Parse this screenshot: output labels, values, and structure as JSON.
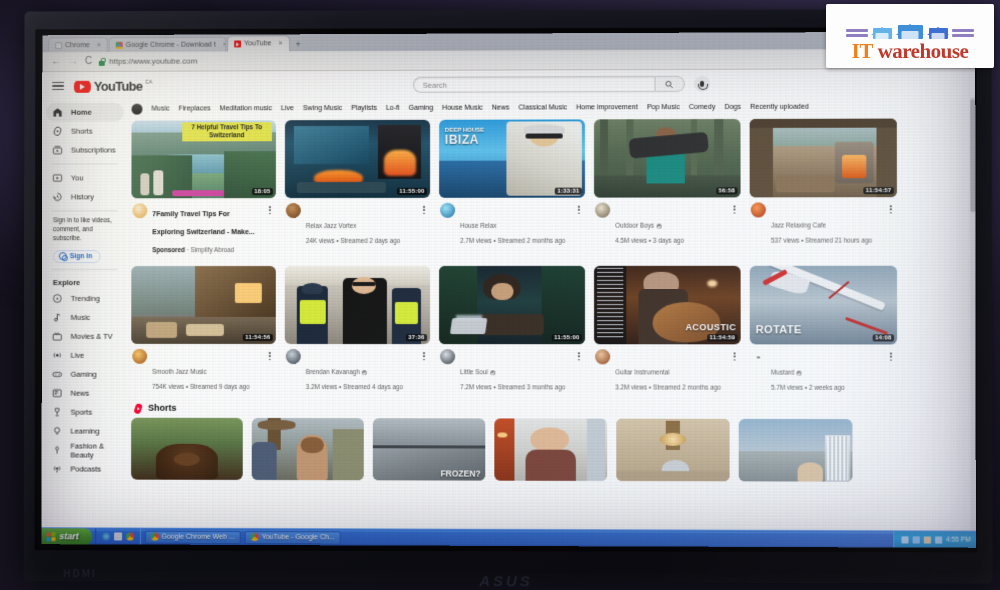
{
  "browser": {
    "tabs": [
      {
        "title": "Chrome",
        "icon": "page-icon",
        "active": false
      },
      {
        "title": "Google Chrome - Download t",
        "icon": "chrome-icon",
        "active": false
      },
      {
        "title": "YouTube",
        "icon": "youtube-icon",
        "active": true
      }
    ],
    "close_glyph": "×",
    "nav": {
      "back": "←",
      "forward": "→",
      "reload": "C"
    },
    "url": "https://www.youtube.com",
    "lock_icon": "lock-icon"
  },
  "youtube": {
    "logo_text": "YouTube",
    "country_code": "CA",
    "search": {
      "placeholder": "Search",
      "search_icon": "search-icon",
      "mic_icon": "microphone-icon"
    },
    "sidebar": {
      "primary": [
        {
          "label": "Home",
          "icon": "home-icon",
          "selected": true
        },
        {
          "label": "Shorts",
          "icon": "shorts-icon",
          "selected": false
        },
        {
          "label": "Subscriptions",
          "icon": "subscriptions-icon",
          "selected": false
        }
      ],
      "secondary": [
        {
          "label": "You",
          "icon": "you-icon"
        },
        {
          "label": "History",
          "icon": "history-icon"
        }
      ],
      "signin_prompt": "Sign in to like videos, comment, and subscribe.",
      "signin_label": "Sign in",
      "explore_heading": "Explore",
      "explore": [
        {
          "label": "Trending",
          "icon": "trending-icon"
        },
        {
          "label": "Music",
          "icon": "music-icon"
        },
        {
          "label": "Movies & TV",
          "icon": "movies-tv-icon"
        },
        {
          "label": "Live",
          "icon": "live-icon"
        },
        {
          "label": "Gaming",
          "icon": "gaming-icon"
        },
        {
          "label": "News",
          "icon": "news-icon"
        },
        {
          "label": "Sports",
          "icon": "sports-icon"
        },
        {
          "label": "Learning",
          "icon": "learning-icon"
        },
        {
          "label": "Fashion & Beauty",
          "icon": "fashion-beauty-icon"
        },
        {
          "label": "Podcasts",
          "icon": "podcasts-icon"
        }
      ]
    },
    "chips": [
      "Music",
      "Fireplaces",
      "Meditation music",
      "Live",
      "Swing Music",
      "Playlists",
      "Lo-fi",
      "Gaming",
      "House Music",
      "News",
      "Classical Music",
      "Home improvement",
      "Pop Music",
      "Comedy",
      "Dogs",
      "Recently uploaded"
    ],
    "rows": [
      [
        {
          "title": "7Family Travel Tips For Exploring Switzerland - Make...",
          "sponsored": true,
          "sponsored_label": "Sponsored",
          "sponsor_name": "Simplify Abroad",
          "channel": "",
          "stats": "",
          "duration": "18:05",
          "overlay_text": "7 Helpful Travel Tips To Switzerland",
          "thumb_style": "lake-mountains",
          "verified": false
        },
        {
          "title": "",
          "channel": "Relax Jazz Vortex",
          "stats": "24K views • Streamed 2 days ago",
          "duration": "11:55:00",
          "overlay_text": "",
          "thumb_style": "fireplace-lounge",
          "verified": false
        },
        {
          "title": "",
          "channel": "House Relax",
          "stats": "2.7M views • Streamed 2 months ago",
          "duration": "1:33:31",
          "overlay_text": "DEEP HOUSE IBIZA",
          "thumb_style": "ibiza-dj",
          "verified": false
        },
        {
          "title": "",
          "channel": "Outdoor Boys",
          "stats": "4.5M views • 3 days ago",
          "duration": "56:58",
          "overlay_text": "",
          "thumb_style": "swamp-man",
          "verified": true
        },
        {
          "title": "",
          "channel": "Jazz Relaxing Cafe",
          "stats": "537 views • Streamed 21 hours ago",
          "duration": "11:54:57",
          "overlay_text": "",
          "thumb_style": "cabin-fireplace",
          "verified": false
        }
      ],
      [
        {
          "title": "",
          "channel": "Smooth Jazz Music",
          "stats": "754K views • Streamed 9 days ago",
          "duration": "11:54:56",
          "overlay_text": "",
          "thumb_style": "snow-cabin",
          "verified": false
        },
        {
          "title": "",
          "channel": "Brendan Kavanagh",
          "stats": "3.2M views • Streamed 4 days ago",
          "duration": "37:36",
          "overlay_text": "",
          "thumb_style": "police-station",
          "verified": true
        },
        {
          "title": "",
          "channel": "Little Soul",
          "stats": "7.2M views • Streamed 3 months ago",
          "duration": "11:55:00",
          "overlay_text": "",
          "thumb_style": "study-anime",
          "verified": true
        },
        {
          "title": "",
          "channel": "Guitar Instrumental",
          "stats": "3.2M views • Streamed 2 months ago",
          "duration": "11:54:59",
          "overlay_text": "ACOUSTIC",
          "thumb_style": "acoustic-guitar",
          "verified": false
        },
        {
          "title": "",
          "channel": "Mustard",
          "stats": "5.7M views • 2 weeks ago",
          "duration": "14:08",
          "overlay_text": "ROTATE",
          "thumb_style": "airplane-rotate",
          "verified": true
        }
      ]
    ],
    "shorts": {
      "heading": "Shorts",
      "icon": "shorts-icon",
      "items": [
        {
          "thumb_style": "brown-dog",
          "overlay_text": ""
        },
        {
          "thumb_style": "market-man",
          "overlay_text": ""
        },
        {
          "thumb_style": "frozen-road",
          "overlay_text": "FROZEN?"
        },
        {
          "thumb_style": "bald-man-plane",
          "overlay_text": ""
        },
        {
          "thumb_style": "chandelier-room",
          "overlay_text": ""
        },
        {
          "thumb_style": "sky-building",
          "overlay_text": ""
        }
      ]
    }
  },
  "taskbar": {
    "start_label": "start",
    "quicklaunch": [
      "ie-icon",
      "show-desktop-icon",
      "chrome-icon"
    ],
    "tasks": [
      {
        "label": "Google Chrome Web ...",
        "icon": "chrome-icon"
      },
      {
        "label": "YouTube - Google Ch...",
        "icon": "chrome-icon"
      }
    ],
    "tray": {
      "icons": [
        "network-icon",
        "display-icon",
        "volume-icon",
        "shield-icon"
      ],
      "clock": "4:55 PM"
    }
  },
  "monitor": {
    "brand": "ASUS",
    "port_label": "HDMI"
  },
  "watermark": {
    "text_part1": "IT",
    "text_part2": "warehouse",
    "color1": "#ef7f1a",
    "color2": "#c0392b",
    "house_color": "#4f9fe0",
    "accent": "#8f7fc0"
  }
}
